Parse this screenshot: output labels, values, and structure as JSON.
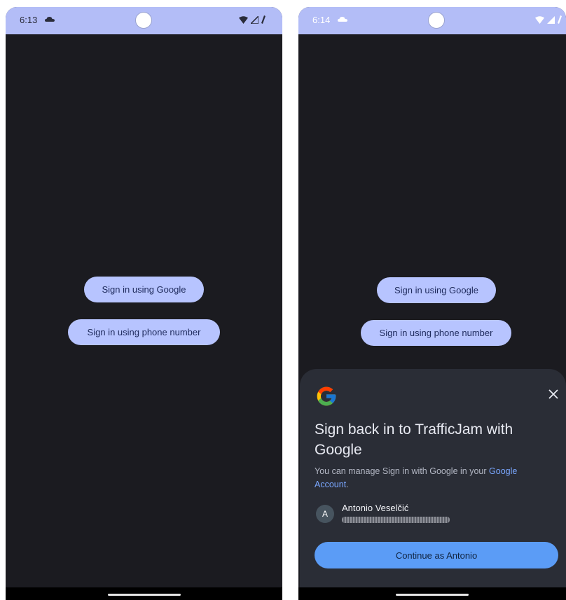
{
  "left_screen": {
    "status": {
      "time": "6:13"
    },
    "buttons": {
      "google": "Sign in using Google",
      "phone": "Sign in using phone number"
    }
  },
  "right_screen": {
    "status": {
      "time": "6:14"
    },
    "buttons": {
      "google": "Sign in using Google",
      "phone": "Sign in using phone number"
    },
    "sheet": {
      "title": "Sign back in to TrafficJam with Google",
      "subtitle": "You can manage Sign in with Google in your ",
      "link": "Google Account",
      "subtitle_end": ".",
      "account": {
        "initial": "A",
        "name": "Antonio Veselčić"
      },
      "continue_label": "Continue as Antonio"
    }
  },
  "colors": {
    "background": "#1b1b20",
    "status_bar": "#b3bdf7",
    "pill_button": "#b7c4ff",
    "sheet": "#2a2d36",
    "continue_button": "#5b9cf6",
    "link": "#7aa7ff"
  },
  "icons": [
    "cloud-icon",
    "wifi-icon",
    "signal-icon",
    "battery-icon",
    "google-g-logo",
    "close-icon"
  ]
}
